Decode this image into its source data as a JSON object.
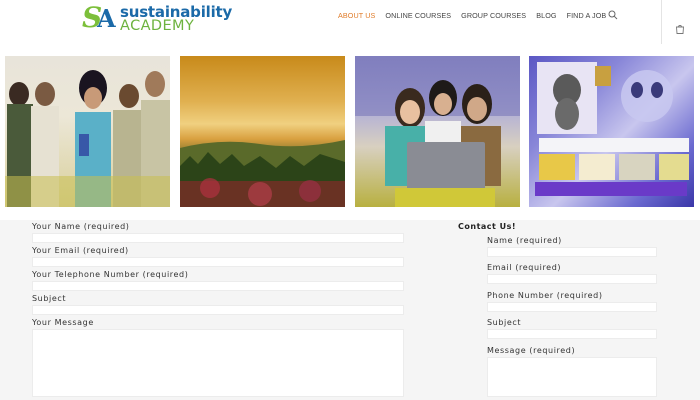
{
  "logo": {
    "mark_s": "S",
    "mark_a": "A",
    "line1": "sustainability",
    "line2": "ACADEMY"
  },
  "nav": {
    "items": [
      "ABOUT US",
      "ONLINE COURSES",
      "GROUP COURSES",
      "BLOG",
      "FIND A JOB"
    ],
    "active_index": 0,
    "active_color": "#e07c2a"
  },
  "icons": {
    "search": "search-icon",
    "cart": "shopping-bag-icon"
  },
  "gallery": [
    "students-group-photo",
    "sunset-landscape-photo",
    "students-laptop-photo",
    "dog-collage-photo"
  ],
  "main_form": {
    "name_label": "Your Name (required)",
    "email_label": "Your Email (required)",
    "phone_label": "Your Telephone Number (required)",
    "subject_label": "Subject",
    "message_label": "Your Message"
  },
  "contact_form": {
    "title": "Contact Us!",
    "name_label": "Name (required)",
    "email_label": "Email (required)",
    "phone_label": "Phone Number (required)",
    "subject_label": "Subject",
    "message_label": "Message (required)"
  }
}
